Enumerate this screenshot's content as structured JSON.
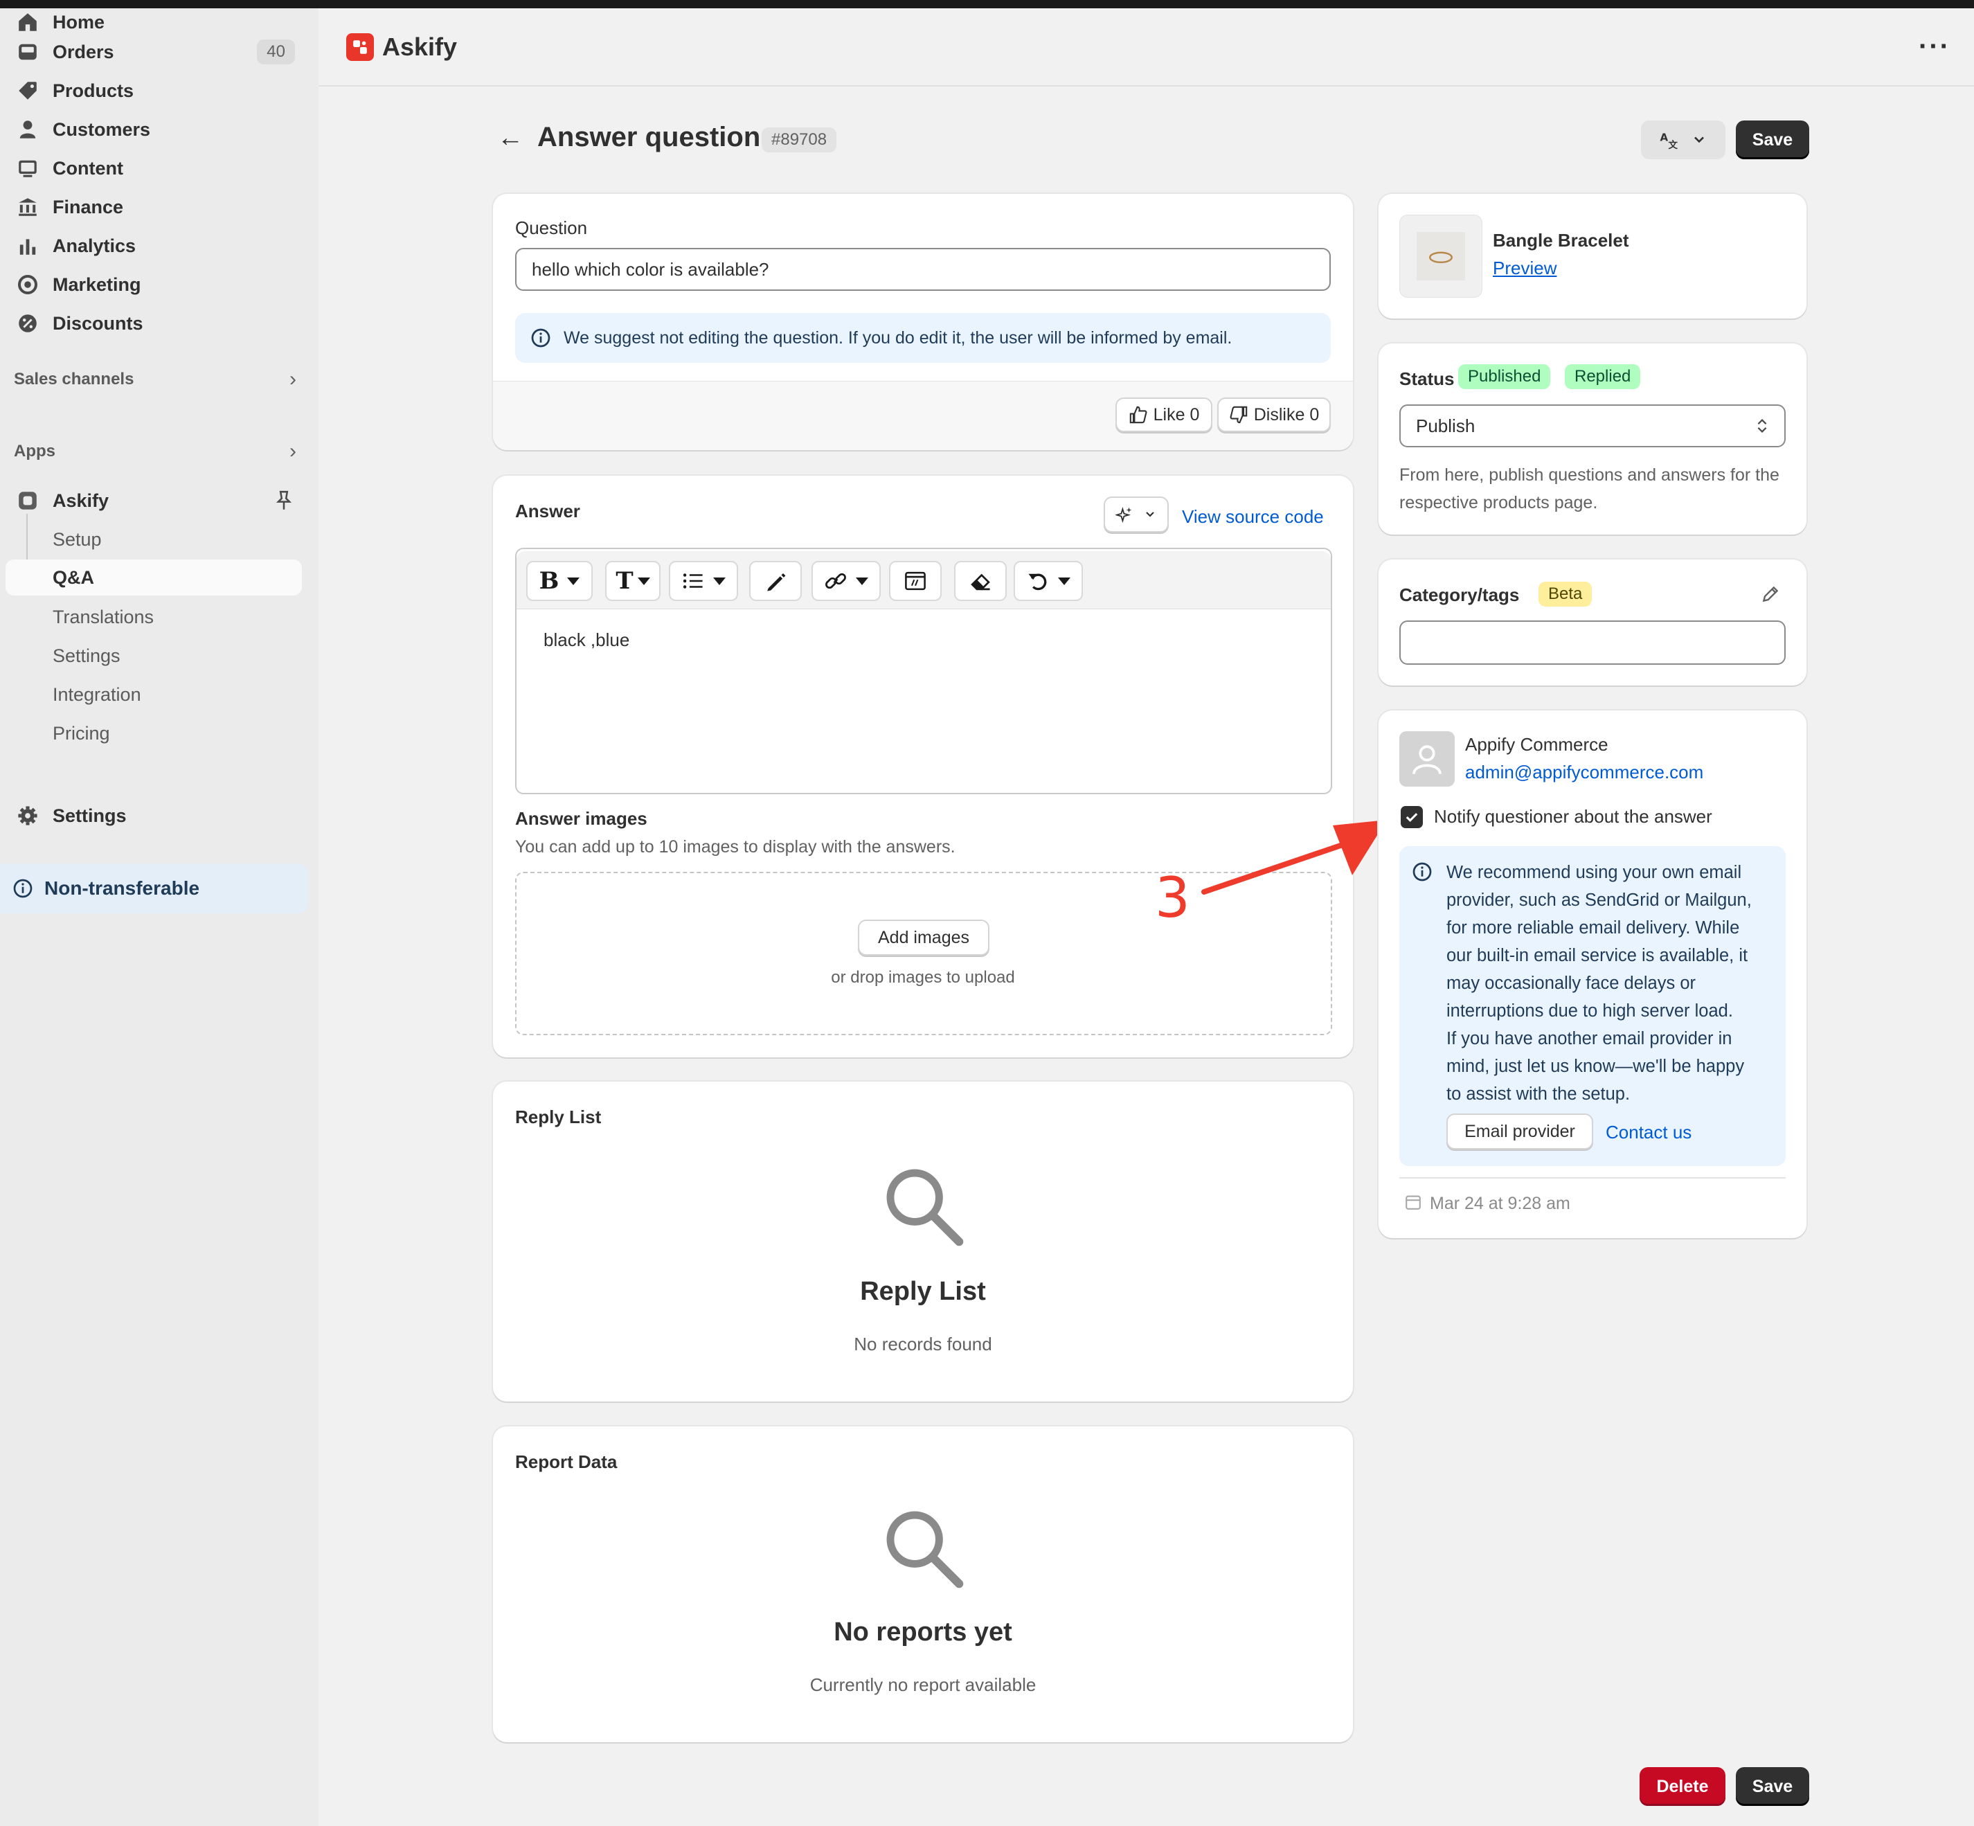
{
  "sidebar": {
    "items": [
      {
        "label": "Home"
      },
      {
        "label": "Orders",
        "count": "40"
      },
      {
        "label": "Products"
      },
      {
        "label": "Customers"
      },
      {
        "label": "Content"
      },
      {
        "label": "Finance"
      },
      {
        "label": "Analytics"
      },
      {
        "label": "Marketing"
      },
      {
        "label": "Discounts"
      }
    ],
    "sales_channels": "Sales channels",
    "apps": "Apps",
    "app_name": "Askify",
    "app_subitems": [
      "Setup",
      "Q&A",
      "Translations",
      "Settings",
      "Integration",
      "Pricing"
    ],
    "settings": "Settings",
    "non_transferable": "Non-transferable"
  },
  "header": {
    "app_title": "Askify"
  },
  "page": {
    "title": "Answer question",
    "id": "#89708",
    "save_label": "Save",
    "delete_label": "Delete"
  },
  "question_card": {
    "label": "Question",
    "value": "hello which color is available?",
    "info": "We suggest not editing the question. If you do edit it, the user will be informed by email.",
    "like": "Like 0",
    "dislike": "Dislike 0"
  },
  "answer_card": {
    "label": "Answer",
    "view_source": "View source code",
    "content": "black ,blue",
    "images_label": "Answer images",
    "images_help": "You can add up to 10 images to display with the answers.",
    "add_images": "Add images",
    "drop_text": "or drop images to upload",
    "annotation": "3"
  },
  "reply_card": {
    "label": "Reply List",
    "empty_title": "Reply List",
    "empty_sub": "No records found"
  },
  "report_card": {
    "label": "Report Data",
    "empty_title": "No reports yet",
    "empty_sub": "Currently no report available"
  },
  "product_card": {
    "name": "Bangle Bracelet",
    "preview": "Preview"
  },
  "status_card": {
    "label": "Status",
    "badge_published": "Published",
    "badge_replied": "Replied",
    "select_value": "Publish",
    "help": "From here, publish questions and answers for the respective products page."
  },
  "category_card": {
    "label": "Category/tags",
    "badge": "Beta"
  },
  "customer_card": {
    "name": "Appify Commerce",
    "email": "admin@appifycommerce.com",
    "notify_label": "Notify questioner about the answer",
    "notify_checked": true,
    "info_lines": [
      "We recommend using your own email",
      "provider, such as SendGrid or Mailgun,",
      "for more reliable email delivery. While",
      "our built-in email service is available, it",
      "may occasionally face delays or",
      "interruptions due to high server load.",
      "If you have another email provider in",
      "mind, just let us know—we'll be happy",
      "to assist with the setup."
    ],
    "email_provider": "Email provider",
    "contact_us": "Contact us",
    "date": "Mar 24 at 9:28 am"
  },
  "colors": {
    "accent_link": "#005bd3",
    "published_bg": "#affebf",
    "beta_bg": "#ffef9d",
    "annotation_red": "#ef3b2c",
    "delete_red": "#c70a24"
  }
}
